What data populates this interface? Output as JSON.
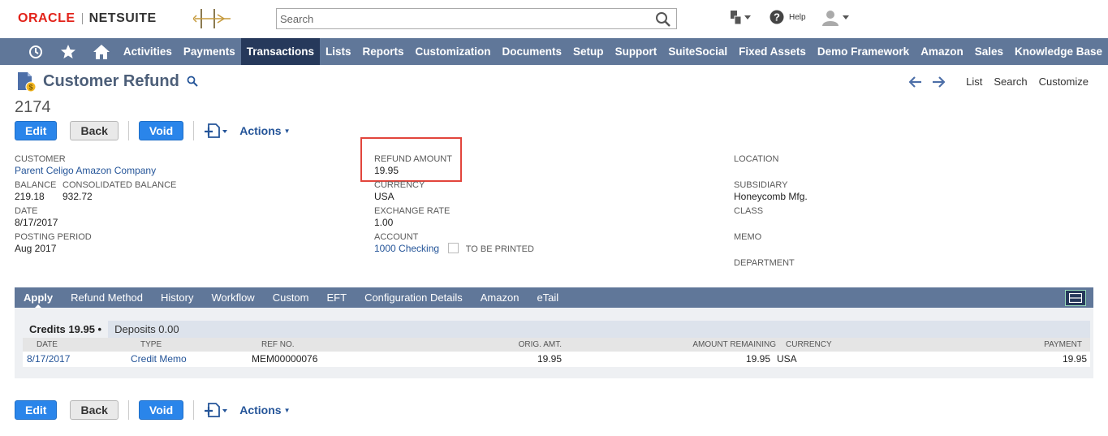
{
  "header": {
    "logo_oracle": "ORACLE",
    "logo_netsuite": "NETSUITE",
    "search_placeholder": "Search",
    "help_label": "Help"
  },
  "nav": {
    "items": [
      "Activities",
      "Payments",
      "Transactions",
      "Lists",
      "Reports",
      "Customization",
      "Documents",
      "Setup",
      "Support",
      "SuiteSocial",
      "Fixed Assets",
      "Demo Framework",
      "Amazon",
      "Sales",
      "Knowledge Base"
    ],
    "active": "Transactions"
  },
  "page": {
    "title": "Customer Refund",
    "record_number": "2174",
    "right_links": [
      "List",
      "Search",
      "Customize"
    ]
  },
  "buttons": {
    "edit": "Edit",
    "back": "Back",
    "void": "Void",
    "actions": "Actions"
  },
  "fields": {
    "customer": {
      "label": "CUSTOMER",
      "value": "Parent Celigo Amazon Company"
    },
    "balance": {
      "label": "BALANCE",
      "value": "219.18"
    },
    "consolidated_balance": {
      "label": "CONSOLIDATED BALANCE",
      "value": "932.72"
    },
    "date": {
      "label": "DATE",
      "value": "8/17/2017"
    },
    "posting_period": {
      "label": "POSTING PERIOD",
      "value": "Aug 2017"
    },
    "refund_amount": {
      "label": "REFUND AMOUNT",
      "value": "19.95"
    },
    "currency": {
      "label": "CURRENCY",
      "value": "USA"
    },
    "exchange_rate": {
      "label": "EXCHANGE RATE",
      "value": "1.00"
    },
    "account": {
      "label": "ACCOUNT",
      "value": "1000 Checking"
    },
    "to_be_printed": {
      "label": "TO BE PRINTED"
    },
    "location": {
      "label": "LOCATION"
    },
    "subsidiary": {
      "label": "SUBSIDIARY",
      "value": "Honeycomb Mfg."
    },
    "class": {
      "label": "CLASS"
    },
    "memo": {
      "label": "MEMO"
    },
    "department": {
      "label": "DEPARTMENT"
    }
  },
  "subtabs": {
    "items": [
      "Apply",
      "Refund Method",
      "History",
      "Workflow",
      "Custom",
      "EFT",
      "Configuration Details",
      "Amazon",
      "eTail"
    ],
    "active": "Apply"
  },
  "apply": {
    "tabs": [
      "Credits 19.95 •",
      "Deposits 0.00"
    ],
    "columns": [
      "DATE",
      "TYPE",
      "REF NO.",
      "ORIG. AMT.",
      "AMOUNT REMAINING",
      "CURRENCY",
      "PAYMENT"
    ],
    "rows": [
      {
        "date": "8/17/2017",
        "type": "Credit Memo",
        "ref_no": "MEM00000076",
        "orig_amt": "19.95",
        "amount_remaining": "19.95",
        "currency": "USA",
        "payment": "19.95"
      }
    ]
  },
  "colors": {
    "nav_bg": "#607799",
    "nav_active": "#26395b",
    "primary_button": "#2a85ea",
    "link": "#255599",
    "highlight": "#e2453c"
  }
}
